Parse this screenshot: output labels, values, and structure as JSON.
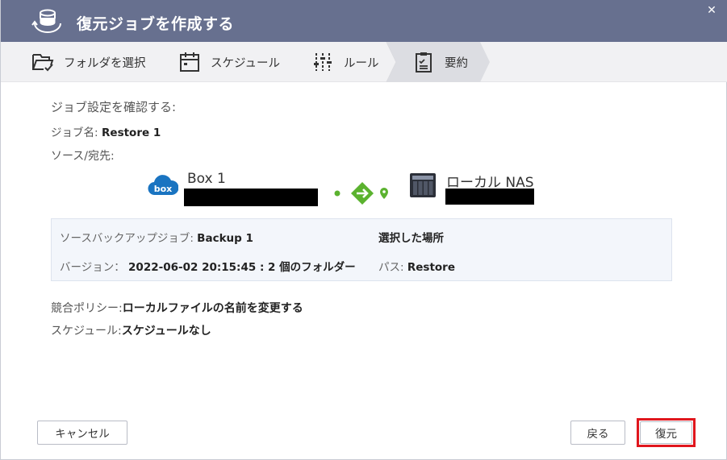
{
  "dialog": {
    "title": "復元ジョブを作成する"
  },
  "steps": [
    {
      "label": "フォルダを選択",
      "icon": "folder-check-icon"
    },
    {
      "label": "スケジュール",
      "icon": "calendar-icon"
    },
    {
      "label": "ルール",
      "icon": "sliders-icon"
    },
    {
      "label": "要約",
      "icon": "clipboard-icon",
      "active": true
    }
  ],
  "summary": {
    "confirm_heading": "ジョブ設定を確認する:",
    "job_name_label": "ジョブ名:",
    "job_name_value": "Restore 1",
    "source_dest_label": "ソース/宛先:",
    "source_name": "Box 1",
    "source_icon_text": "box",
    "dest_name": "ローカル NAS",
    "source_backup_label": "ソースバックアップジョブ:",
    "source_backup_value": "Backup 1",
    "version_label": "バージョン：",
    "version_value": "2022-06-02 20:15:45 : 2 個のフォルダー",
    "selected_location_label": "選択した場所",
    "path_label": "パス:",
    "path_value": "Restore",
    "conflict_label": "競合ポリシー:",
    "conflict_value": "ローカルファイルの名前を変更する",
    "schedule_label": "スケジュール:",
    "schedule_value": "スケジュールなし"
  },
  "buttons": {
    "cancel": "キャンセル",
    "back": "戻る",
    "restore": "復元"
  },
  "colors": {
    "titlebar": "#67708f",
    "box_brand": "#1a74c1",
    "connector_green": "#5bb22f",
    "highlight_red": "#e0161d"
  }
}
